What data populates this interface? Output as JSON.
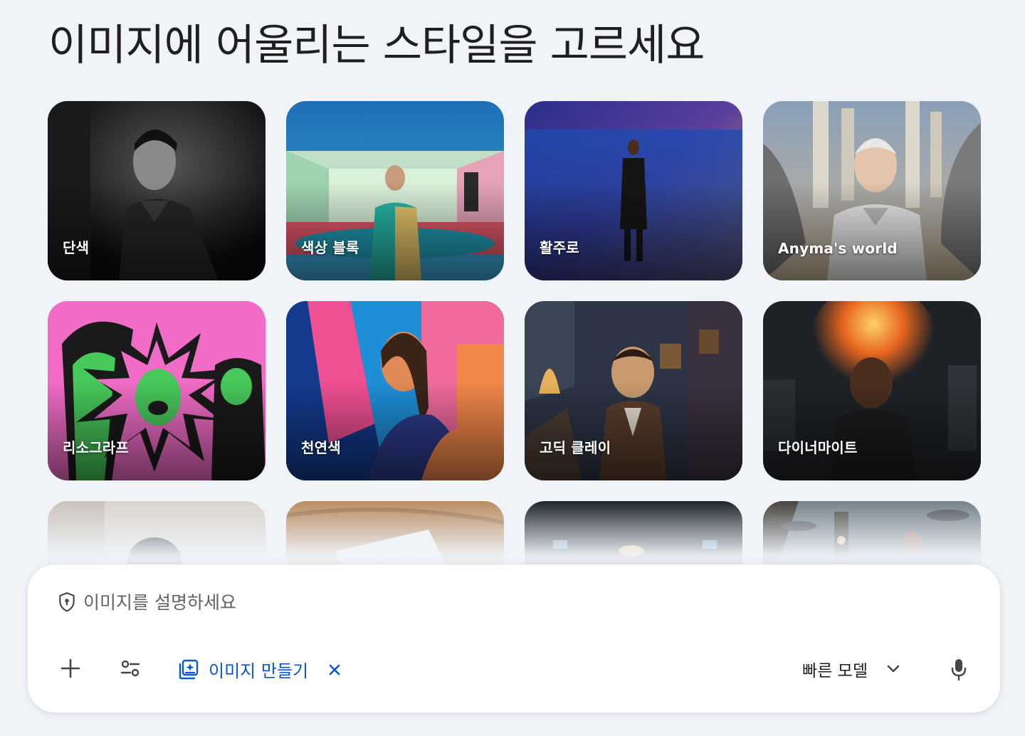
{
  "heading": "이미지에 어울리는 스타일을 고르세요",
  "styles": [
    {
      "label": "단색"
    },
    {
      "label": "색상 블록"
    },
    {
      "label": "활주로"
    },
    {
      "label": "Anyma's world"
    },
    {
      "label": "리소그라프"
    },
    {
      "label": "천연색"
    },
    {
      "label": "고딕 클레이"
    },
    {
      "label": "다이너마이트"
    }
  ],
  "composer": {
    "placeholder": "이미지를 설명하세요",
    "tool_chip_label": "이미지 만들기",
    "model_label": "빠른 모델"
  },
  "colors": {
    "accent": "#0b57d0",
    "background": "#f0f4f9"
  }
}
